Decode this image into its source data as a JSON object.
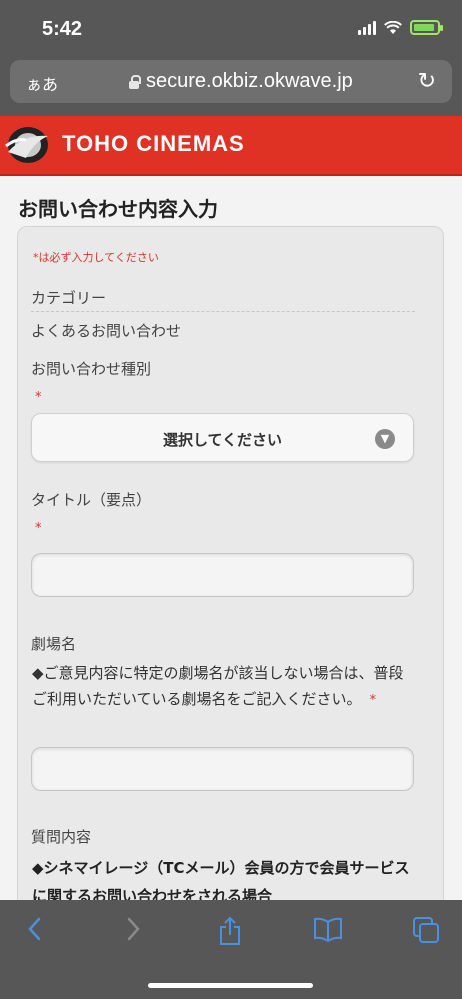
{
  "status_bar": {
    "time": "5:42"
  },
  "browser": {
    "aa_label": "ぁあ",
    "url": "secure.okbiz.okwave.jp",
    "reload_icon": "reload-icon"
  },
  "brand": {
    "name": "TOHO CINEMAS",
    "color": "#e03224"
  },
  "page": {
    "title": "お問い合わせ内容入力"
  },
  "form": {
    "required_note": "*は必ず入力してください",
    "required_star": "*",
    "category": {
      "label": "カテゴリー",
      "value": "よくあるお問い合わせ"
    },
    "inquiry_type": {
      "label": "お問い合わせ種別",
      "selected": "選択してください"
    },
    "title_field": {
      "label": "タイトル（要点）",
      "value": ""
    },
    "theater": {
      "label": "劇場名",
      "description": "◆ご意見内容に特定の劇場名が該当しない場合は、普段ご利用いただいている劇場名をご記入ください。",
      "value": ""
    },
    "question": {
      "label": "質問内容",
      "note": "◆シネマイレージ（TCメール）会員の方で会員サービスに関するお問い合わせをされる場合"
    }
  },
  "toolbar": {
    "back": "back-icon",
    "forward": "forward-icon",
    "share": "share-icon",
    "bookmarks": "bookmarks-icon",
    "tabs": "tabs-icon"
  }
}
